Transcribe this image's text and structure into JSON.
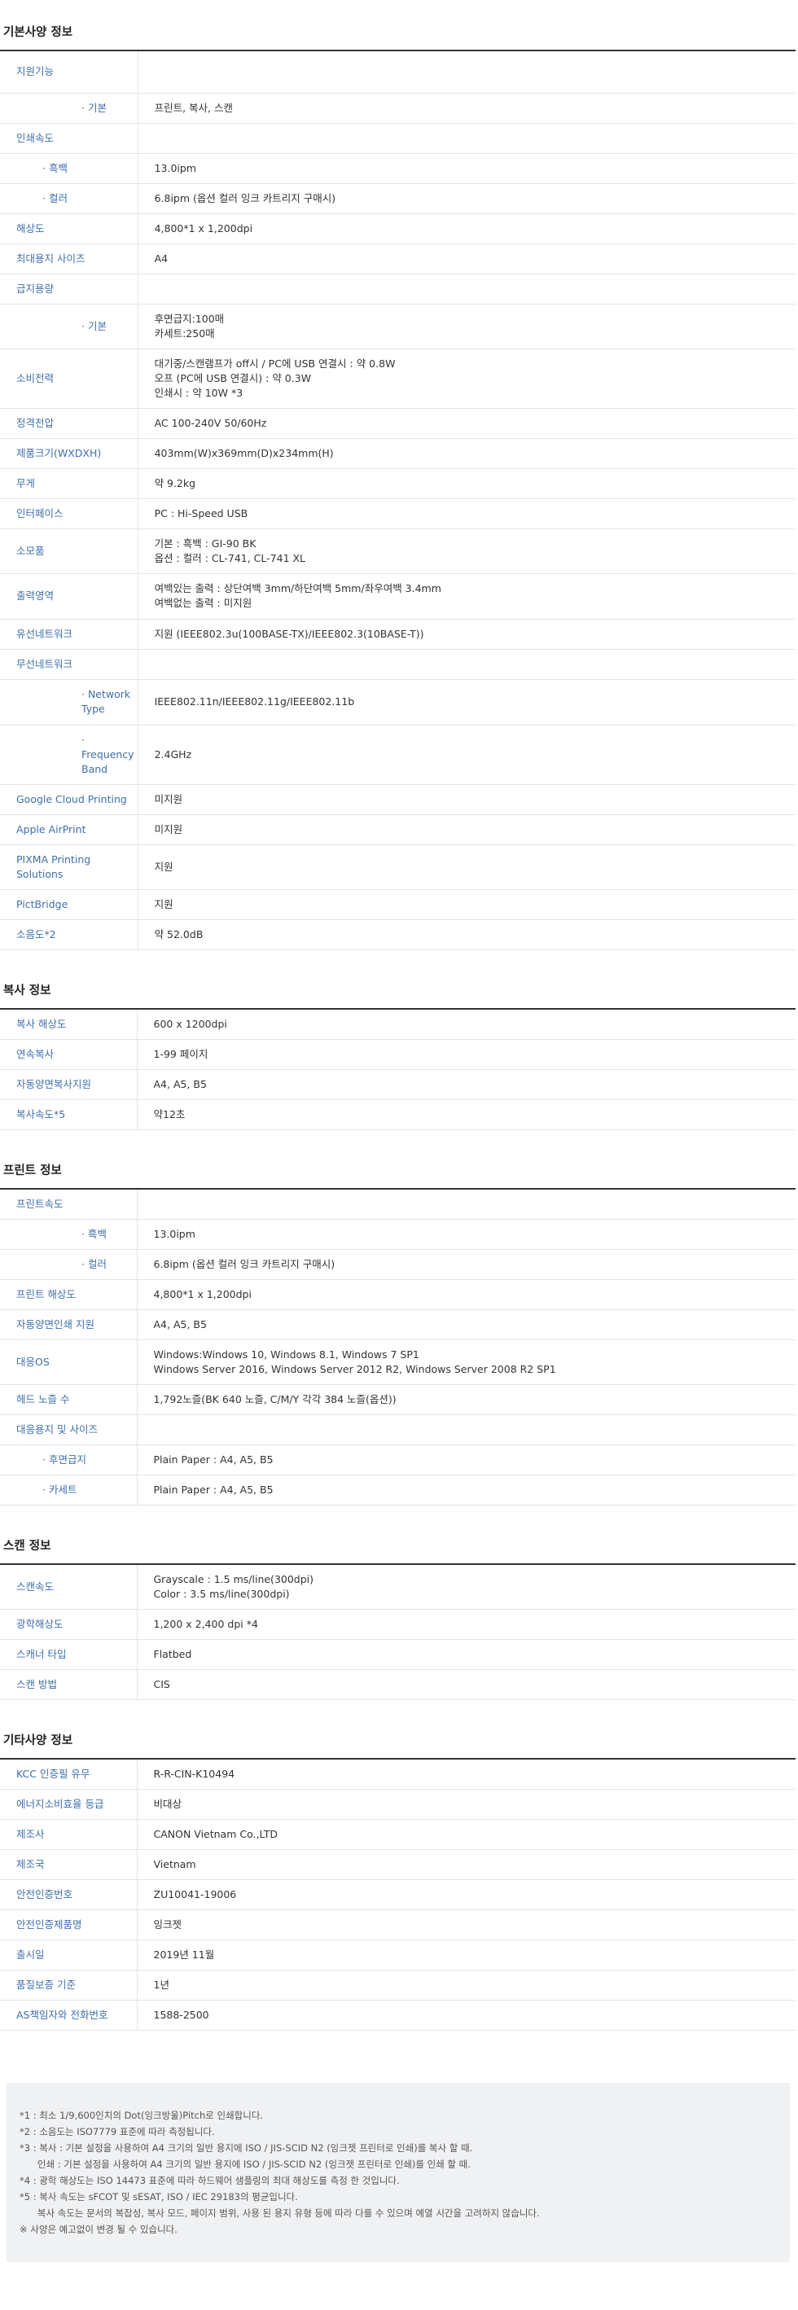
{
  "sections": [
    {
      "title": "기본사양 정보",
      "rows": [
        {
          "k": "지원기능",
          "v": "",
          "cls": "",
          "h": "r50"
        },
        {
          "k": "· 기본",
          "v": "프린트, 복사, 스캔",
          "cls": "sub",
          "h": "r38"
        },
        {
          "k": "인쇄속도",
          "v": "",
          "cls": "",
          "h": "r38"
        },
        {
          "k": "· 흑백",
          "v": "13.0ipm",
          "cls": "sub2",
          "h": "r38"
        },
        {
          "k": "· 컬러",
          "v": "6.8ipm (옵션 컬러 잉크 카트리지 구매시)",
          "cls": "sub2",
          "h": "r38"
        },
        {
          "k": "해상도",
          "v": "4,800*1 x 1,200dpi",
          "cls": "",
          "h": "r38"
        },
        {
          "k": "최대용지 사이즈",
          "v": "A4",
          "cls": "",
          "h": "r38"
        },
        {
          "k": "급지용량",
          "v": "",
          "cls": "",
          "h": "r38"
        },
        {
          "k": "· 기본",
          "v": "후면급지:100매\n카세트:250매",
          "cls": "sub",
          "h": "r50"
        },
        {
          "k": "소비전력",
          "v": "대기중/스캔램프가 off시 / PC에 USB 연결시 : 약 0.8W\n오프 (PC에 USB 연결시) : 약 0.3W\n인쇄시 : 약 10W *3",
          "cls": "",
          "h": "r64"
        },
        {
          "k": "정격전압",
          "v": "AC 100-240V 50/60Hz",
          "cls": "",
          "h": "r38"
        },
        {
          "k": "제품크기(WXDXH)",
          "v": "403mm(W)x369mm(D)x234mm(H)",
          "cls": "",
          "h": "r38"
        },
        {
          "k": "무게",
          "v": "약 9.2kg",
          "cls": "",
          "h": "r38"
        },
        {
          "k": "인터페이스",
          "v": "PC : Hi-Speed USB",
          "cls": "",
          "h": "r38"
        },
        {
          "k": "소모품",
          "v": "기본 : 흑백 : GI-90 BK\n옵션 : 컬러 : CL-741, CL-741 XL",
          "cls": "",
          "h": "r50"
        },
        {
          "k": "출력영역",
          "v": "여백있는 출력 : 상단여백 3mm/하단여백 5mm/좌우여백 3.4mm\n여백없는 출력 : 미지원",
          "cls": "",
          "h": "r56"
        },
        {
          "k": "유선네트워크",
          "v": "지원 (IEEE802.3u(100BASE-TX)/IEEE802.3(10BASE-T))",
          "cls": "",
          "h": "r38"
        },
        {
          "k": "무선네트워크",
          "v": "",
          "cls": "",
          "h": "r38"
        },
        {
          "k": "· Network\nType",
          "v": "IEEE802.11n/IEEE802.11g/IEEE802.11b",
          "cls": "sub",
          "h": "r56"
        },
        {
          "k": "· Frequency\nBand",
          "v": "2.4GHz",
          "cls": "sub",
          "h": "r56"
        },
        {
          "k": "Google Cloud Printing",
          "v": "미지원",
          "cls": "",
          "h": "r38"
        },
        {
          "k": "Apple AirPrint",
          "v": "미지원",
          "cls": "",
          "h": "r38"
        },
        {
          "k": "PIXMA Printing Solutions",
          "v": "지원",
          "cls": "",
          "h": "r38"
        },
        {
          "k": "PictBridge",
          "v": "지원",
          "cls": "",
          "h": "r38"
        },
        {
          "k": "소음도*2",
          "v": "약 52.0dB",
          "cls": "",
          "h": "r38"
        }
      ]
    },
    {
      "title": "복사 정보",
      "rows": [
        {
          "k": "복사 해상도",
          "v": "600 x 1200dpi",
          "cls": "",
          "h": "r38"
        },
        {
          "k": "연속복사",
          "v": "1-99 페이지",
          "cls": "",
          "h": "r38"
        },
        {
          "k": "자동양면복사지원",
          "v": "A4, A5, B5",
          "cls": "",
          "h": "r38"
        },
        {
          "k": "복사속도*5",
          "v": "약12초",
          "cls": "",
          "h": "r38"
        }
      ]
    },
    {
      "title": "프린트 정보",
      "rows": [
        {
          "k": "프린트속도",
          "v": "",
          "cls": "",
          "h": "r38"
        },
        {
          "k": "· 흑백",
          "v": "13.0ipm",
          "cls": "sub",
          "h": "r38"
        },
        {
          "k": "· 컬러",
          "v": "6.8ipm (옵션 컬러 잉크 카트리지 구매시)",
          "cls": "sub",
          "h": "r38"
        },
        {
          "k": "프린트 해상도",
          "v": "4,800*1 x 1,200dpi",
          "cls": "",
          "h": "r38"
        },
        {
          "k": "자동양면인쇄 지원",
          "v": "A4, A5, B5",
          "cls": "",
          "h": "r38"
        },
        {
          "k": "대응OS",
          "v": "Windows:Windows 10, Windows 8.1, Windows 7 SP1\nWindows Server 2016, Windows Server 2012 R2, Windows Server 2008 R2 SP1",
          "cls": "",
          "h": "r50"
        },
        {
          "k": "헤드 노즐 수",
          "v": "1,792노즐(BK 640 노즐, C/M/Y 각각 384 노즐(옵션))",
          "cls": "",
          "h": "r38"
        },
        {
          "k": "대응용지 및 사이즈",
          "v": "",
          "cls": "",
          "h": "r38"
        },
        {
          "k": "· 후면급지",
          "v": "Plain Paper : A4, A5, B5",
          "cls": "sub2",
          "h": "r38"
        },
        {
          "k": "· 카세트",
          "v": "Plain Paper : A4, A5, B5",
          "cls": "sub2",
          "h": "r38"
        }
      ]
    },
    {
      "title": "스캔 정보",
      "rows": [
        {
          "k": "스캔속도",
          "v": "Grayscale : 1.5 ms/line(300dpi)\nColor : 3.5 ms/line(300dpi)",
          "cls": "",
          "h": "r50"
        },
        {
          "k": "광학해상도",
          "v": "1,200 x 2,400 dpi *4",
          "cls": "",
          "h": "r38"
        },
        {
          "k": "스캐너 타입",
          "v": "Flatbed",
          "cls": "",
          "h": "r38"
        },
        {
          "k": "스캔 방법",
          "v": "CIS",
          "cls": "",
          "h": "r38"
        }
      ]
    },
    {
      "title": "기타사양 정보",
      "rows": [
        {
          "k": "KCC 인증필 유무",
          "v": "R-R-CIN-K10494",
          "cls": "",
          "h": "r38"
        },
        {
          "k": "에너지소비효율 등급",
          "v": "비대상",
          "cls": "",
          "h": "r38"
        },
        {
          "k": "제조사",
          "v": "CANON Vietnam Co.,LTD",
          "cls": "",
          "h": "r38"
        },
        {
          "k": "제조국",
          "v": "Vietnam",
          "cls": "",
          "h": "r38"
        },
        {
          "k": "안전인증번호",
          "v": "ZU10041-19006",
          "cls": "",
          "h": "r38"
        },
        {
          "k": "안전인증제품명",
          "v": "잉크젯",
          "cls": "",
          "h": "r38"
        },
        {
          "k": "출시일",
          "v": "2019년 11월",
          "cls": "",
          "h": "r38"
        },
        {
          "k": "품질보증 기준",
          "v": "1년",
          "cls": "",
          "h": "r38"
        },
        {
          "k": "AS책임자와 전화번호",
          "v": "1588-2500",
          "cls": "",
          "h": "r38"
        }
      ]
    }
  ],
  "notes": [
    "*1 : 최소 1/9,600인치의 Dot(잉크방울)Pitch로 인쇄합니다.",
    "*2 : 소음도는 ISO7779 표준에 따라 측정됩니다.",
    "*3 : 복사 : 기본 설정을 사용하여 A4 크기의 일반 용지에 ISO / JIS-SCID N2 (잉크젯 프린터로 인쇄)를 복사 할 때.",
    "      인쇄 : 기본 설정을 사용하여 A4 크기의 일반 용지에 ISO / JIS-SCID N2 (잉크젯 프린터로 인쇄)를 인쇄 할 때.",
    "*4 : 광학 해상도는 ISO 14473 표준에 따라 하드웨어 샘플링의 최대 해상도를 측정 한 것입니다.",
    "*5 : 복사 속도는 sFCOT 및 sESAT, ISO / IEC 29183의 평균입니다.",
    "      복사 속도는 문서의 복잡성, 복사 모드, 페이지 범위, 사용 된 용지 유형 등에 따라 다를 수 있으며 예열 시간을 고려하지 않습니다.",
    "※ 사양은 예고없이 변경 될 수 있습니다."
  ]
}
